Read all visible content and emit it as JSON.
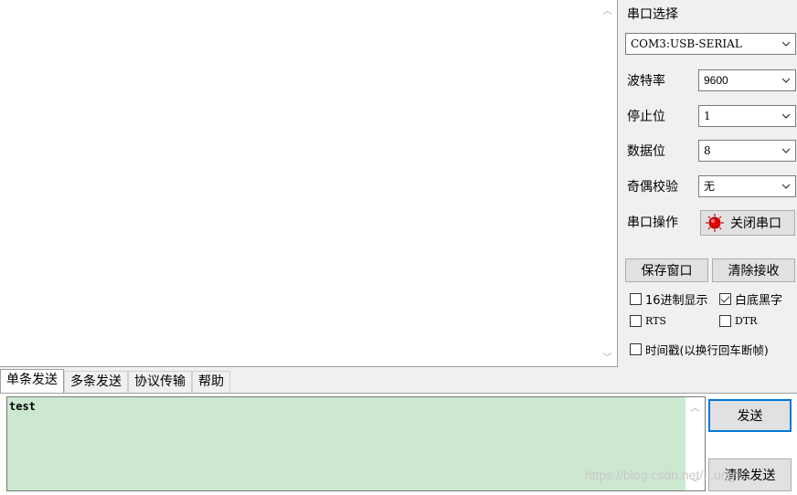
{
  "receive": {
    "text": ""
  },
  "port_panel": {
    "port_select_label": "串口选择",
    "port_value": "COM3:USB-SERIAL",
    "baud_label": "波特率",
    "baud_value": "9600",
    "stop_label": "停止位",
    "stop_value": "1",
    "data_label": "数据位",
    "data_value": "8",
    "parity_label": "奇偶校验",
    "parity_value": "无",
    "op_label": "串口操作",
    "op_button": "关闭串口",
    "op_status_color": "#e00000",
    "save_window": "保存窗口",
    "clear_receive": "清除接收",
    "hex_display": "16进制显示",
    "hex_display_checked": false,
    "white_black": "白底黑字",
    "white_black_checked": true,
    "rts": "RTS",
    "rts_checked": false,
    "dtr": "DTR",
    "dtr_checked": false,
    "timestamp": "时间戳(以换行回车断帧)",
    "timestamp_checked": false
  },
  "tabs": [
    "单条发送",
    "多条发送",
    "协议传输",
    "帮助"
  ],
  "send": {
    "text": "test",
    "send_button": "发送",
    "clear_send_button": "清除发送",
    "background_color": "#cde8d0"
  },
  "watermark": "https://blog.csdn.net/...ung"
}
